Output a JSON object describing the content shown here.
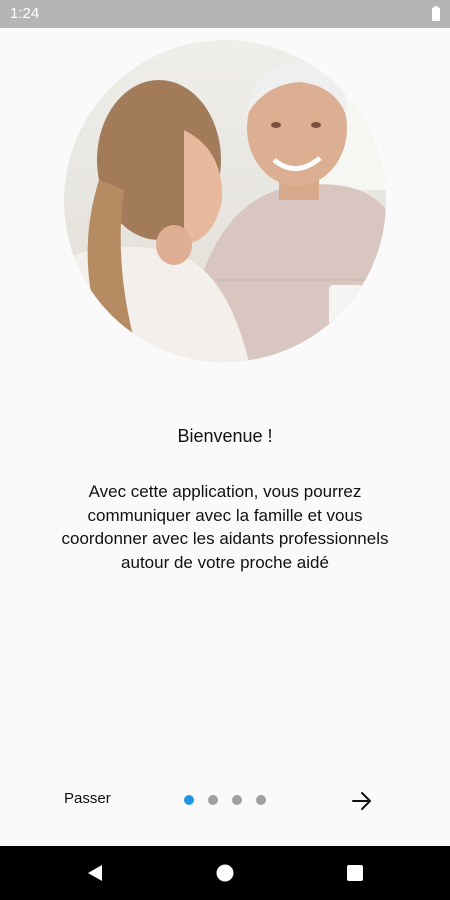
{
  "status_bar": {
    "time": "1:24",
    "battery_icon": "battery-full-icon"
  },
  "hero": {
    "image": "elderly-man-with-young-woman-photo"
  },
  "onboarding": {
    "title": "Bienvenue !",
    "body_lines": [
      "Avec cette application, vous pourrez",
      "communiquer avec la famille et vous",
      "coordonner avec les aidants professionnels",
      "autour de votre proche aidé"
    ]
  },
  "controls": {
    "skip_label": "Passer",
    "pages_total": 4,
    "current_page": 1,
    "next_icon": "arrow-right-icon"
  },
  "colors": {
    "accent": "#1e96e6",
    "dot_inactive": "#a0a0a0",
    "status_bar": "#b5b5b5",
    "background": "#fafafa"
  },
  "nav_bar": {
    "back_icon": "back-triangle-icon",
    "home_icon": "home-circle-icon",
    "recents_icon": "recents-square-icon"
  }
}
